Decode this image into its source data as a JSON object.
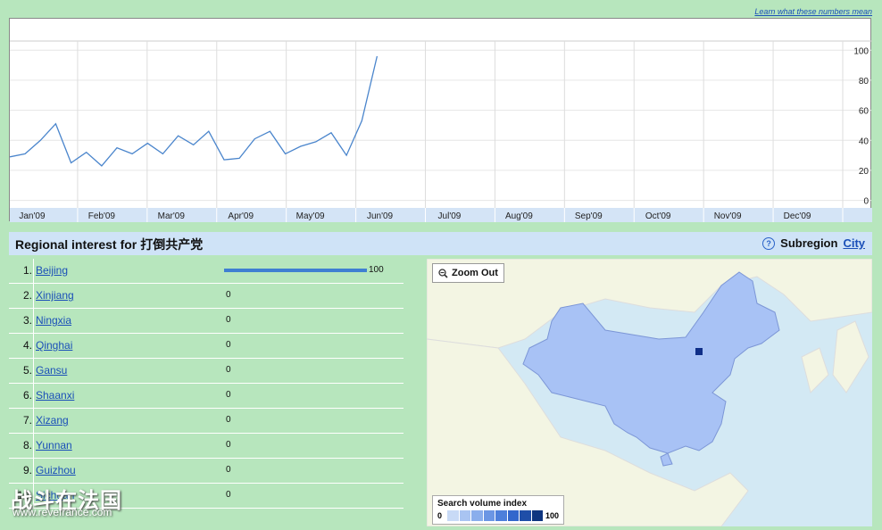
{
  "header": {
    "learn_link": "Learn what these numbers mean"
  },
  "chart_data": {
    "type": "line",
    "x": [
      "Jan'09",
      "Feb'09",
      "Mar'09",
      "Apr'09",
      "May'09",
      "Jun'09",
      "Jul'09",
      "Aug'09",
      "Sep'09",
      "Oct'09",
      "Nov'09",
      "Dec'09"
    ],
    "y_ticks": [
      0,
      20,
      40,
      60,
      80,
      100
    ],
    "ylim": [
      -5,
      115
    ],
    "series": [
      {
        "values": [
          29,
          31,
          40,
          51,
          25,
          32,
          23,
          35,
          31,
          38,
          31,
          43,
          37,
          46,
          27,
          28,
          41,
          46,
          31,
          36,
          39,
          45,
          30,
          53,
          96
        ]
      }
    ],
    "series_start_month": 0,
    "series_step_months": 0.22,
    "line_color": "#4a85cc",
    "grid": true
  },
  "region": {
    "title_prefix": "Regional interest",
    "title_for": "for",
    "query": "打倒共产党",
    "subregion_label": "Subregion",
    "city_link": "City",
    "help_icon": "help-icon"
  },
  "regions": [
    {
      "rank": "1.",
      "name": "Beijing",
      "value": 100
    },
    {
      "rank": "2.",
      "name": "Xinjiang",
      "value": 0
    },
    {
      "rank": "3.",
      "name": "Ningxia",
      "value": 0
    },
    {
      "rank": "4.",
      "name": "Qinghai",
      "value": 0
    },
    {
      "rank": "5.",
      "name": "Gansu",
      "value": 0
    },
    {
      "rank": "6.",
      "name": "Shaanxi",
      "value": 0
    },
    {
      "rank": "7.",
      "name": "Xizang",
      "value": 0
    },
    {
      "rank": "8.",
      "name": "Yunnan",
      "value": 0
    },
    {
      "rank": "9.",
      "name": "Guizhou",
      "value": 0
    },
    {
      "rank": "10.",
      "name": "Sichuan",
      "value": 0
    }
  ],
  "map": {
    "zoom_out_label": "Zoom Out",
    "legend_title": "Search volume index",
    "legend_min": "0",
    "legend_max": "100",
    "legend_colors": [
      "#c8daf6",
      "#a9c4f2",
      "#8aaeec",
      "#6b96e4",
      "#4d7fdb",
      "#3367cc",
      "#1f4ea8",
      "#0e3580"
    ]
  },
  "watermark": {
    "line1": "战斗在法国",
    "line2": "www.revefrance.com"
  }
}
